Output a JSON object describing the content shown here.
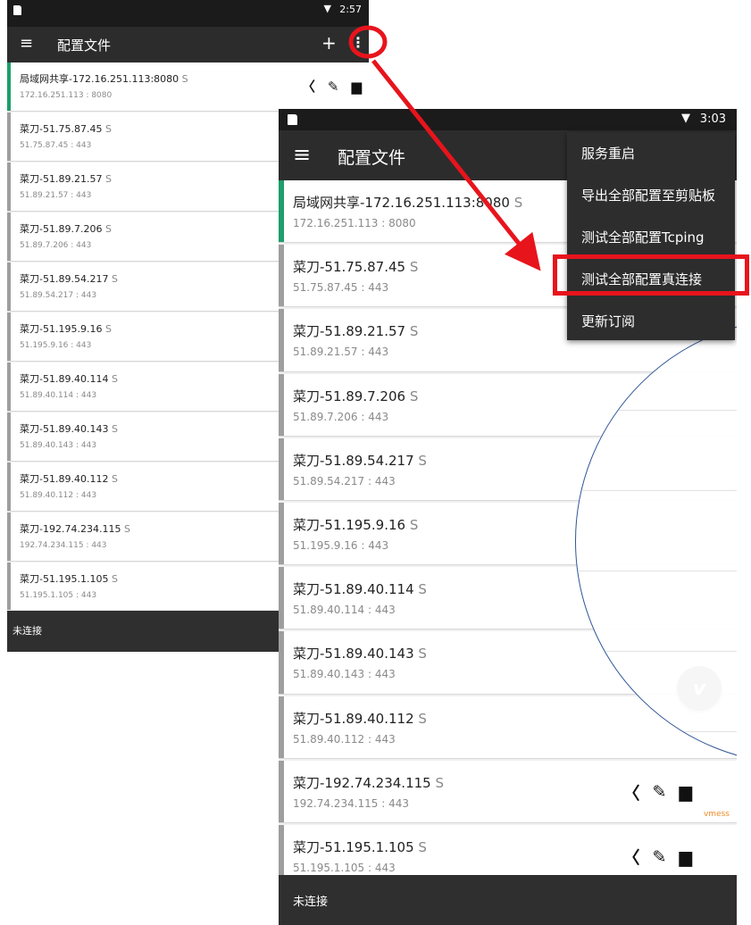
{
  "back": {
    "time": "2:57",
    "title": "配置文件",
    "status": "未连接",
    "items": [
      {
        "name": "局域网共享-172.16.251.113:8080",
        "tag": "S",
        "addr": "172.16.251.113 : 8080",
        "active": true
      },
      {
        "name": "菜刀-51.75.87.45",
        "tag": "S",
        "addr": "51.75.87.45 : 443"
      },
      {
        "name": "菜刀-51.89.21.57",
        "tag": "S",
        "addr": "51.89.21.57 : 443"
      },
      {
        "name": "菜刀-51.89.7.206",
        "tag": "S",
        "addr": "51.89.7.206 : 443"
      },
      {
        "name": "菜刀-51.89.54.217",
        "tag": "S",
        "addr": "51.89.54.217 : 443"
      },
      {
        "name": "菜刀-51.195.9.16",
        "tag": "S",
        "addr": "51.195.9.16 : 443"
      },
      {
        "name": "菜刀-51.89.40.114",
        "tag": "S",
        "addr": "51.89.40.114 : 443"
      },
      {
        "name": "菜刀-51.89.40.143",
        "tag": "S",
        "addr": "51.89.40.143 : 443"
      },
      {
        "name": "菜刀-51.89.40.112",
        "tag": "S",
        "addr": "51.89.40.112 : 443"
      },
      {
        "name": "菜刀-192.74.234.115",
        "tag": "S",
        "addr": "192.74.234.115 : 443"
      },
      {
        "name": "菜刀-51.195.1.105",
        "tag": "S",
        "addr": "51.195.1.105 : 443"
      }
    ]
  },
  "front": {
    "time": "3:03",
    "title": "配置文件",
    "status": "未连接",
    "protocol_label": "vmess",
    "items": [
      {
        "name": "局域网共享-172.16.251.113:8080",
        "tag": "S",
        "addr": "172.16.251.113 : 8080",
        "active": true
      },
      {
        "name": "菜刀-51.75.87.45",
        "tag": "S",
        "addr": "51.75.87.45 : 443"
      },
      {
        "name": "菜刀-51.89.21.57",
        "tag": "S",
        "addr": "51.89.21.57 : 443"
      },
      {
        "name": "菜刀-51.89.7.206",
        "tag": "S",
        "addr": "51.89.7.206 : 443"
      },
      {
        "name": "菜刀-51.89.54.217",
        "tag": "S",
        "addr": "51.89.54.217 : 443"
      },
      {
        "name": "菜刀-51.195.9.16",
        "tag": "S",
        "addr": "51.195.9.16 : 443"
      },
      {
        "name": "菜刀-51.89.40.114",
        "tag": "S",
        "addr": "51.89.40.114 : 443"
      },
      {
        "name": "菜刀-51.89.40.143",
        "tag": "S",
        "addr": "51.89.40.143 : 443"
      },
      {
        "name": "菜刀-51.89.40.112",
        "tag": "S",
        "addr": "51.89.40.112 : 443"
      },
      {
        "name": "菜刀-192.74.234.115",
        "tag": "S",
        "addr": "192.74.234.115 : 443"
      },
      {
        "name": "菜刀-51.195.1.105",
        "tag": "S",
        "addr": "51.195.1.105 : 443"
      }
    ],
    "menu": [
      "服务重启",
      "导出全部配置至剪贴板",
      "测试全部配置Tcping",
      "测试全部配置真连接",
      "更新订阅"
    ]
  },
  "icons": {
    "menu": "hamburger-icon",
    "add": "plus-icon",
    "overflow": "more-vert-icon",
    "share": "share-icon",
    "edit": "pencil-icon",
    "delete": "trash-icon",
    "fab": "v-logo-icon",
    "wifi": "wifi-icon",
    "sim": "sim-icon"
  },
  "colors": {
    "highlight": "#e8141c",
    "active_bar": "#1e9e6a",
    "inactive_bar": "#9e9e9e",
    "magnifier_stroke": "#2f5597",
    "protocol": "#f08a24"
  }
}
